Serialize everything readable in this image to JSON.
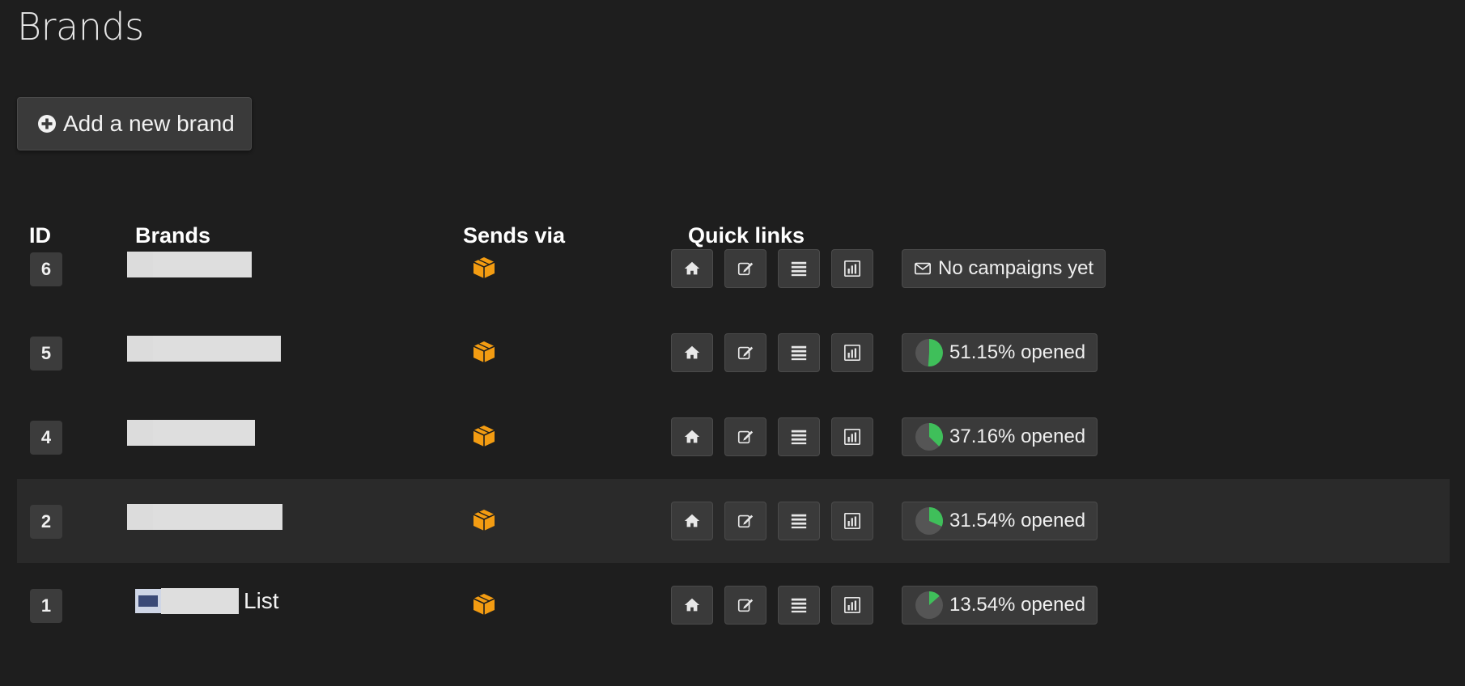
{
  "page": {
    "title": "Brands"
  },
  "actions": {
    "add_brand_label": "Add a new brand"
  },
  "table": {
    "headers": {
      "id": "ID",
      "brands": "Brands",
      "sends_via": "Sends via",
      "quick_links": "Quick links"
    },
    "rows": [
      {
        "id": "6",
        "brand_name": "",
        "stat_label": "No campaigns yet",
        "open_rate": null,
        "highlighted": false
      },
      {
        "id": "5",
        "brand_name": "",
        "stat_label": "51.15% opened",
        "open_rate": 51.15,
        "highlighted": false
      },
      {
        "id": "4",
        "brand_name": "",
        "stat_label": "37.16% opened",
        "open_rate": 37.16,
        "highlighted": false
      },
      {
        "id": "2",
        "brand_name": "",
        "stat_label": "31.54% opened",
        "open_rate": 31.54,
        "highlighted": true
      },
      {
        "id": "1",
        "brand_name": "List",
        "stat_label": "13.54% opened",
        "open_rate": 13.54,
        "highlighted": false
      }
    ]
  },
  "icons": {
    "add": "plus-circle-icon",
    "sends_via": "amazon-ses-box-icon",
    "quick_links": [
      "home-icon",
      "edit-icon",
      "list-icon",
      "reports-icon"
    ],
    "no_campaigns": "envelope-icon"
  },
  "colors": {
    "background": "#1e1e1e",
    "button": "#3a3a3a",
    "ses_orange": "#f39c12",
    "pie_green": "#3fbf5a",
    "pie_gray": "#555555"
  }
}
